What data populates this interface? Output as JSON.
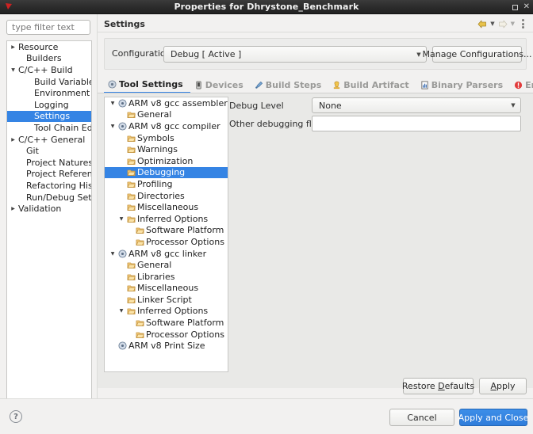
{
  "window": {
    "title": "Properties for Dhrystone_Benchmark",
    "app_icon": "eclipse-icon",
    "maximize_label": "□",
    "close_label": "✕"
  },
  "filter": {
    "placeholder": "type filter text",
    "value": ""
  },
  "nav_tree": {
    "items": [
      {
        "label": "Resource",
        "indent": 0,
        "arrow": "right",
        "selected": false
      },
      {
        "label": "Builders",
        "indent": 1,
        "arrow": "none",
        "selected": false
      },
      {
        "label": "C/C++ Build",
        "indent": 0,
        "arrow": "down",
        "selected": false
      },
      {
        "label": "Build Variables",
        "indent": 2,
        "arrow": "none",
        "selected": false
      },
      {
        "label": "Environment",
        "indent": 2,
        "arrow": "none",
        "selected": false
      },
      {
        "label": "Logging",
        "indent": 2,
        "arrow": "none",
        "selected": false
      },
      {
        "label": "Settings",
        "indent": 2,
        "arrow": "none",
        "selected": true
      },
      {
        "label": "Tool Chain Editor",
        "indent": 2,
        "arrow": "none",
        "selected": false
      },
      {
        "label": "C/C++ General",
        "indent": 0,
        "arrow": "right",
        "selected": false
      },
      {
        "label": "Git",
        "indent": 1,
        "arrow": "none",
        "selected": false
      },
      {
        "label": "Project Natures",
        "indent": 1,
        "arrow": "none",
        "selected": false
      },
      {
        "label": "Project References",
        "indent": 1,
        "arrow": "none",
        "selected": false
      },
      {
        "label": "Refactoring History",
        "indent": 1,
        "arrow": "none",
        "selected": false
      },
      {
        "label": "Run/Debug Settings",
        "indent": 1,
        "arrow": "none",
        "selected": false
      },
      {
        "label": "Validation",
        "indent": 0,
        "arrow": "right",
        "selected": false
      }
    ]
  },
  "page": {
    "title": "Settings",
    "toolbar": [
      {
        "name": "back-arrow-icon",
        "enabled": true
      },
      {
        "name": "back-dropdown-icon",
        "enabled": true
      },
      {
        "name": "forward-arrow-icon",
        "enabled": false
      },
      {
        "name": "forward-dropdown-icon",
        "enabled": false
      },
      {
        "name": "view-menu-icon",
        "enabled": true
      }
    ]
  },
  "configuration": {
    "label": "Configuration:",
    "value": "Debug  [ Active ]",
    "manage_button": "Manage Configurations..."
  },
  "tabs": [
    {
      "label": "Tool Settings",
      "icon": "tool-settings-icon",
      "active": true
    },
    {
      "label": "Devices",
      "icon": "devices-icon",
      "active": false
    },
    {
      "label": "Build Steps",
      "icon": "build-steps-icon",
      "active": false
    },
    {
      "label": "Build Artifact",
      "icon": "build-artifact-icon",
      "active": false
    },
    {
      "label": "Binary Parsers",
      "icon": "binary-parsers-icon",
      "active": false
    },
    {
      "label": "Error Parsers",
      "icon": "error-parsers-icon",
      "active": false
    }
  ],
  "option_tree": {
    "items": [
      {
        "label": "ARM v8 gcc assembler",
        "indent": 0,
        "arrow": "down",
        "icon": "tool-icon",
        "selected": false
      },
      {
        "label": "General",
        "indent": 1,
        "arrow": "none",
        "icon": "folder-icon",
        "selected": false
      },
      {
        "label": "ARM v8 gcc compiler",
        "indent": 0,
        "arrow": "down",
        "icon": "tool-icon",
        "selected": false
      },
      {
        "label": "Symbols",
        "indent": 1,
        "arrow": "none",
        "icon": "folder-icon",
        "selected": false
      },
      {
        "label": "Warnings",
        "indent": 1,
        "arrow": "none",
        "icon": "folder-icon",
        "selected": false
      },
      {
        "label": "Optimization",
        "indent": 1,
        "arrow": "none",
        "icon": "folder-icon",
        "selected": false
      },
      {
        "label": "Debugging",
        "indent": 1,
        "arrow": "none",
        "icon": "folder-icon",
        "selected": true
      },
      {
        "label": "Profiling",
        "indent": 1,
        "arrow": "none",
        "icon": "folder-icon",
        "selected": false
      },
      {
        "label": "Directories",
        "indent": 1,
        "arrow": "none",
        "icon": "folder-icon",
        "selected": false
      },
      {
        "label": "Miscellaneous",
        "indent": 1,
        "arrow": "none",
        "icon": "folder-icon",
        "selected": false
      },
      {
        "label": "Inferred Options",
        "indent": 1,
        "arrow": "down",
        "icon": "folder-icon",
        "selected": false
      },
      {
        "label": "Software Platform",
        "indent": 2,
        "arrow": "none",
        "icon": "folder-icon",
        "selected": false
      },
      {
        "label": "Processor Options",
        "indent": 2,
        "arrow": "none",
        "icon": "folder-icon",
        "selected": false
      },
      {
        "label": "ARM v8 gcc linker",
        "indent": 0,
        "arrow": "down",
        "icon": "tool-icon",
        "selected": false
      },
      {
        "label": "General",
        "indent": 1,
        "arrow": "none",
        "icon": "folder-icon",
        "selected": false
      },
      {
        "label": "Libraries",
        "indent": 1,
        "arrow": "none",
        "icon": "folder-icon",
        "selected": false
      },
      {
        "label": "Miscellaneous",
        "indent": 1,
        "arrow": "none",
        "icon": "folder-icon",
        "selected": false
      },
      {
        "label": "Linker Script",
        "indent": 1,
        "arrow": "none",
        "icon": "folder-icon",
        "selected": false
      },
      {
        "label": "Inferred Options",
        "indent": 1,
        "arrow": "down",
        "icon": "folder-icon",
        "selected": false
      },
      {
        "label": "Software Platform",
        "indent": 2,
        "arrow": "none",
        "icon": "folder-icon",
        "selected": false
      },
      {
        "label": "Processor Options",
        "indent": 2,
        "arrow": "none",
        "icon": "folder-icon",
        "selected": false
      },
      {
        "label": "ARM v8 Print Size",
        "indent": 0,
        "arrow": "none",
        "icon": "tool-icon",
        "selected": false
      }
    ]
  },
  "form": {
    "debug_level_label": "Debug Level",
    "debug_level_value": "None",
    "other_flags_label": "Other debugging flags",
    "other_flags_value": "",
    "other_flags_placeholder": ""
  },
  "buttons": {
    "restore_defaults": "Restore Defaults",
    "apply": "Apply",
    "cancel": "Cancel",
    "apply_and_close": "Apply and Close"
  },
  "footer": {
    "help_glyph": "?"
  },
  "colors": {
    "selection_blue": "#3584e4",
    "primary_button": "#2f7ddb",
    "dialog_bg": "#f2f1f0",
    "panel_bg": "#e9e9e7",
    "titlebar_bg": "#2c2c2c"
  }
}
